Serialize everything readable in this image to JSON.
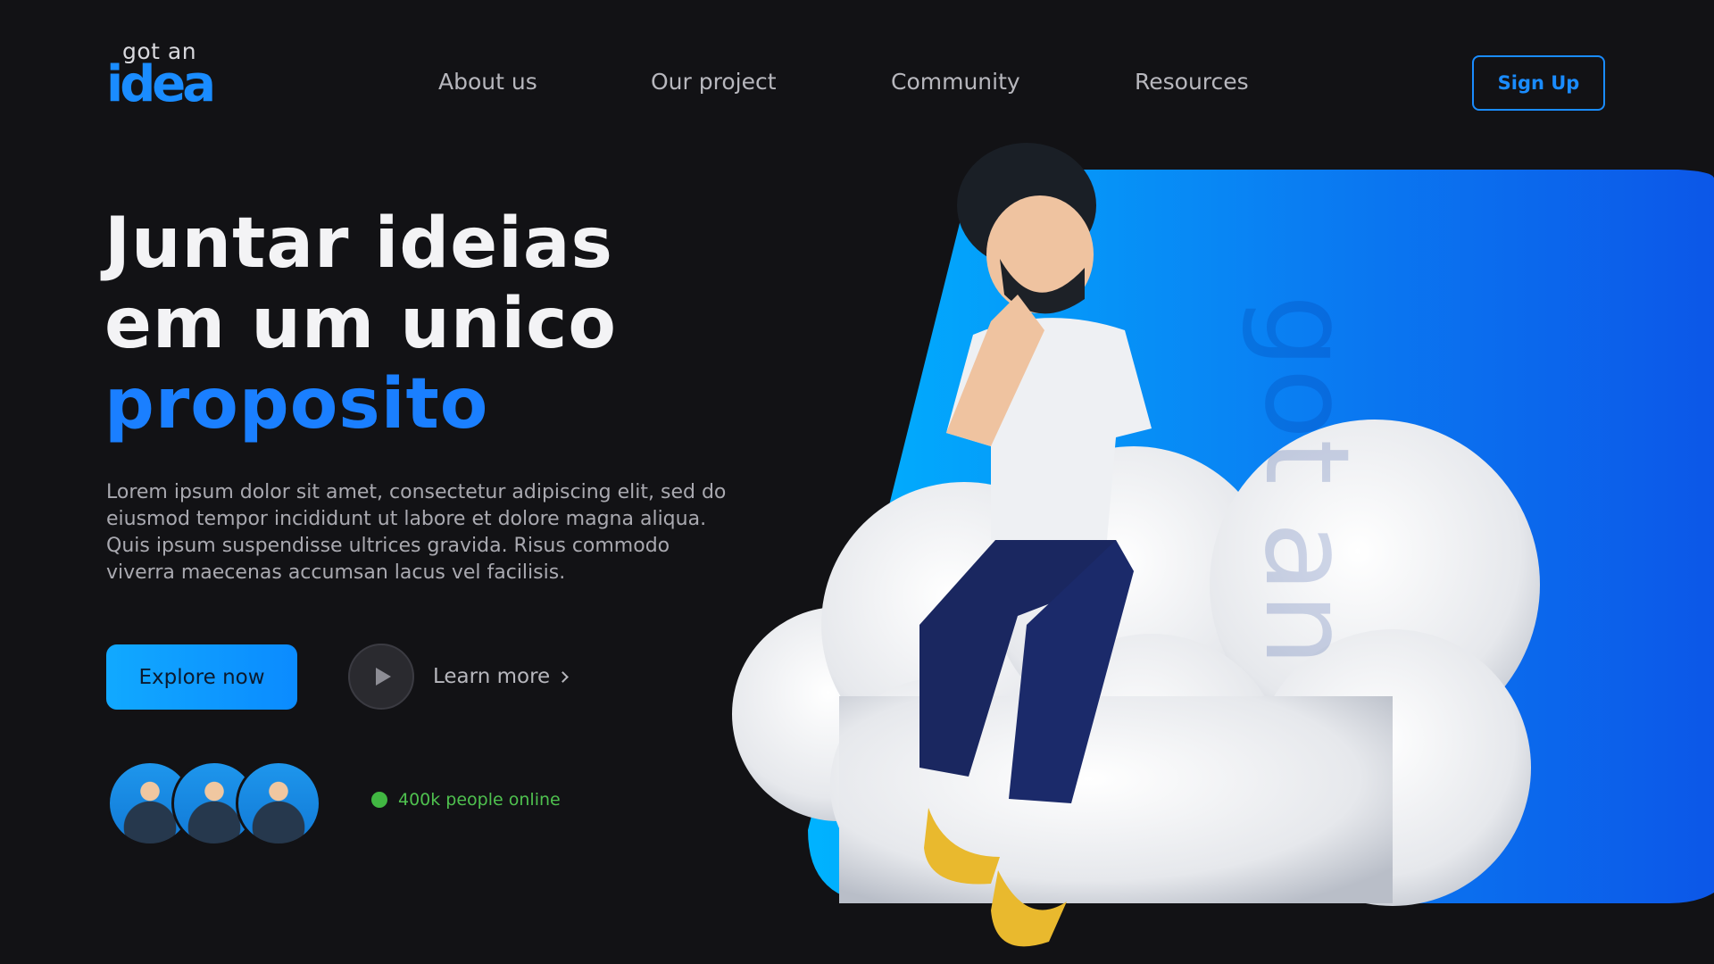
{
  "brand": {
    "logo_top": "got an",
    "logo_word": "idea"
  },
  "nav": {
    "items": [
      "About us",
      "Our project",
      "Community",
      "Resources"
    ]
  },
  "header": {
    "signup_label": "Sign Up"
  },
  "hero": {
    "headline_line1": "Juntar ideias",
    "headline_line2": "em um unico",
    "headline_line3": "proposito",
    "description": "Lorem ipsum dolor sit amet, consectetur adipiscing elit, sed do eiusmod tempor incididunt ut labore et dolore magna aliqua. Quis ipsum suspendisse ultrices gravida. Risus commodo viverra maecenas accumsan lacus vel facilisis.",
    "explore_label": "Explore now",
    "learn_label": "Learn more",
    "online_text": "400k people online"
  },
  "colors": {
    "background": "#121215",
    "accent": "#1a8cff",
    "online": "#41b742"
  }
}
